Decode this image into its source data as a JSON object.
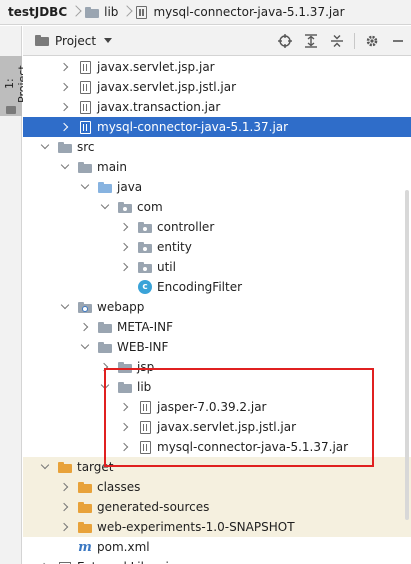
{
  "breadcrumb": {
    "project": "testJDBC",
    "folder": "lib",
    "file": "mysql-connector-java-5.1.37.jar"
  },
  "sidebar": {
    "tab_label": "1: Project"
  },
  "toolbar": {
    "view_label": "Project"
  },
  "colors": {
    "selection": "#2f6dc9",
    "highlight_rows": "#f5f0df",
    "annotation_box": "#e02020",
    "folder_blue": "#87b3e0",
    "folder_yellow": "#e8a23a",
    "folder_gray": "#9aa5b1"
  },
  "tree": [
    {
      "label": "javax.servlet.jsp.jar",
      "depth": 1,
      "expand": "right",
      "icon": "jar"
    },
    {
      "label": "javax.servlet.jsp.jstl.jar",
      "depth": 1,
      "expand": "right",
      "icon": "jar"
    },
    {
      "label": "javax.transaction.jar",
      "depth": 1,
      "expand": "right",
      "icon": "jar"
    },
    {
      "label": "mysql-connector-java-5.1.37.jar",
      "depth": 1,
      "expand": "right",
      "icon": "jar",
      "selected": true
    },
    {
      "label": "src",
      "depth": 0,
      "expand": "down",
      "icon": "folder-gray"
    },
    {
      "label": "main",
      "depth": 1,
      "expand": "down",
      "icon": "folder-gray"
    },
    {
      "label": "java",
      "depth": 2,
      "expand": "down",
      "icon": "folder-blue"
    },
    {
      "label": "com",
      "depth": 3,
      "expand": "down",
      "icon": "package"
    },
    {
      "label": "controller",
      "depth": 4,
      "expand": "right",
      "icon": "package"
    },
    {
      "label": "entity",
      "depth": 4,
      "expand": "right",
      "icon": "package"
    },
    {
      "label": "util",
      "depth": 4,
      "expand": "right",
      "icon": "package"
    },
    {
      "label": "EncodingFilter",
      "depth": 4,
      "expand": "none",
      "icon": "class"
    },
    {
      "label": "webapp",
      "depth": 1,
      "expand": "down",
      "icon": "folder-web"
    },
    {
      "label": "META-INF",
      "depth": 2,
      "expand": "right",
      "icon": "folder-gray"
    },
    {
      "label": "WEB-INF",
      "depth": 2,
      "expand": "down",
      "icon": "folder-gray"
    },
    {
      "label": "jsp",
      "depth": 3,
      "expand": "right",
      "icon": "folder-gray"
    },
    {
      "label": "lib",
      "depth": 3,
      "expand": "down",
      "icon": "folder-gray"
    },
    {
      "label": "jasper-7.0.39.2.jar",
      "depth": 4,
      "expand": "right",
      "icon": "jar"
    },
    {
      "label": "javax.servlet.jsp.jstl.jar",
      "depth": 4,
      "expand": "right",
      "icon": "jar"
    },
    {
      "label": "mysql-connector-java-5.1.37.jar",
      "depth": 4,
      "expand": "right",
      "icon": "jar"
    },
    {
      "label": "target",
      "depth": 0,
      "expand": "down",
      "icon": "folder-yellow",
      "highlight": true
    },
    {
      "label": "classes",
      "depth": 1,
      "expand": "right",
      "icon": "folder-yellow",
      "highlight": true
    },
    {
      "label": "generated-sources",
      "depth": 1,
      "expand": "right",
      "icon": "folder-yellow",
      "highlight": true
    },
    {
      "label": "web-experiments-1.0-SNAPSHOT",
      "depth": 1,
      "expand": "right",
      "icon": "folder-yellow",
      "highlight": true
    },
    {
      "label": "pom.xml",
      "depth": 1,
      "expand": "none",
      "icon": "maven"
    },
    {
      "label": "External Libraries",
      "depth": 0,
      "expand": "right",
      "icon": "ext-lib"
    }
  ]
}
